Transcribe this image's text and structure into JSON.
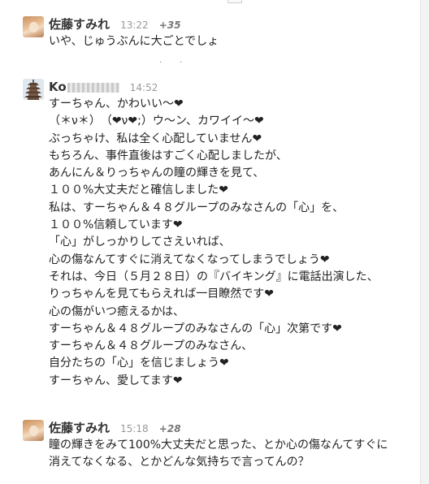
{
  "posts": [
    {
      "author": "佐藤すみれ",
      "time": "13:22",
      "plus": "+35",
      "lines": [
        "いや、じゅうぶんに大ごとでしょ"
      ]
    },
    {
      "author_visible": "Ko",
      "time": "14:52",
      "lines": [
        "すーちゃん、かわいい〜❤",
        "（＊ν＊）　（❤ν❤;）ウ〜ン、カワイイ〜❤",
        "ぶっちゃけ、私は全く心配していません❤",
        "もちろん、事件直後はすごく心配しましたが、",
        "あんにん＆りっちゃんの瞳の輝きを見て、",
        "１００%大丈夫だと確信しました❤",
        "私は、すーちゃん＆４８グループのみなさんの「心」を、",
        "１００%信頼しています❤",
        "「心」がしっかりしてさえいれば、",
        "心の傷なんてすぐに消えてなくなってしまうでしょう❤",
        "それは、今日（５月２８日）の『バイキング』に電話出演した、",
        "りっちゃんを見てもらえれば一目瞭然です❤",
        "心の傷がいつ癒えるかは、",
        "すーちゃん＆４８グループのみなさんの「心」次第です❤",
        "すーちゃん＆４８グループのみなさん、",
        "自分たちの「心」を信じましょう❤",
        "すーちゃん、愛してます❤"
      ]
    },
    {
      "author": "佐藤すみれ",
      "time": "15:18",
      "plus": "+28",
      "lines": [
        "瞳の輝きをみて100%大丈夫だと思った、とか心の傷なんてすぐに",
        "消えてなくなる、とかどんな気持ちで言ってんの？"
      ]
    }
  ]
}
